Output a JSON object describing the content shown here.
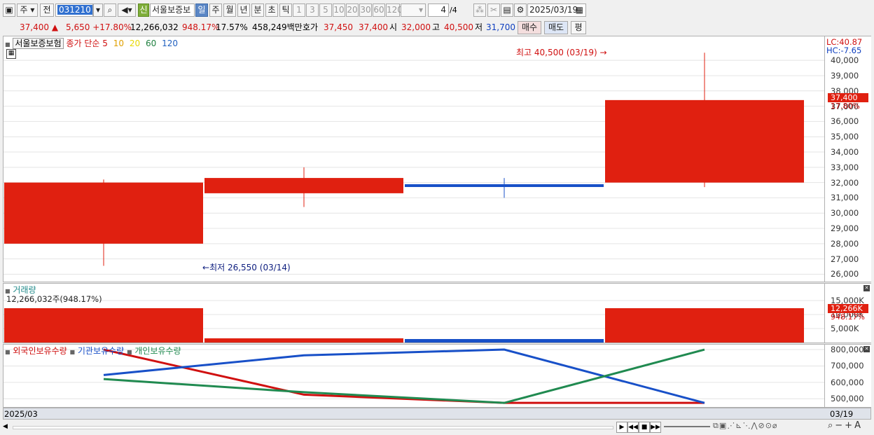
{
  "toolbar": {
    "market": "주",
    "prev": "전",
    "code": "031210",
    "new_badge": "신",
    "stock_name": "서울보증보",
    "periods": [
      "일",
      "주",
      "월",
      "년",
      "분",
      "초",
      "틱"
    ],
    "selected_period": "일",
    "intervals": [
      "1",
      "3",
      "5",
      "10",
      "20",
      "30",
      "60",
      "120"
    ],
    "count": "4",
    "count_total": "/4",
    "date": "2025/03/19"
  },
  "info": {
    "price": "37,400",
    "change": "5,650",
    "change_pct": "+17.80%",
    "volume": "12,266,032",
    "volume_ratio": "948.17%",
    "turnover": "17.57%",
    "amount": "458,249백만",
    "quote_label": "호가",
    "ask": "37,450",
    "bid": "37,400",
    "open_label": "시",
    "open": "32,000",
    "high_label": "고",
    "high": "40,500",
    "low_label": "저",
    "low": "31,700",
    "buy_label": "매수",
    "sell_label": "매도",
    "eval_label": "평"
  },
  "price_panel": {
    "legend_name": "서울보증보험",
    "legend_ma": "종가 단순",
    "ma_periods": [
      {
        "label": "5",
        "color": "#d01010"
      },
      {
        "label": "10",
        "color": "#e0a000"
      },
      {
        "label": "20",
        "color": "#e8d800"
      },
      {
        "label": "60",
        "color": "#208040"
      },
      {
        "label": "120",
        "color": "#2060c0"
      }
    ],
    "high_note": "최고 40,500 (03/19)",
    "low_note": "최저 26,550 (03/14)",
    "lc": "LC:40.87",
    "hc": "HC:-7.65",
    "ticks": [
      "40,000",
      "39,000",
      "38,000",
      "37,000",
      "36,000",
      "35,000",
      "34,000",
      "33,000",
      "32,000",
      "31,000",
      "30,000",
      "29,000",
      "28,000",
      "27,000",
      "26,000"
    ],
    "last_tag": "37,400",
    "last_pct": "17.80%"
  },
  "volume_panel": {
    "title": "거래량",
    "info": "12,266,032주(948.17%)",
    "ticks": [
      "15,000K",
      "10,000K",
      "5,000K"
    ],
    "last_tag": "12,266K",
    "last_pct": "948.17%"
  },
  "holdings_panel": {
    "legend": [
      {
        "label": "외국인보유수량",
        "color": "#d01010"
      },
      {
        "label": "기관보유수량",
        "color": "#1850c8"
      },
      {
        "label": "개인보유수량",
        "color": "#208a50"
      }
    ],
    "ticks": [
      "800,000",
      "700,000",
      "600,000",
      "500,000"
    ]
  },
  "footer": {
    "left_date": "2025/03",
    "right_date": "03/19"
  },
  "chart_data": {
    "type": "candlestick",
    "candles": [
      {
        "open": 32000,
        "high": 32200,
        "low": 26550,
        "close": 28000,
        "color": "#e02010",
        "volume": 12266032
      },
      {
        "open": 31300,
        "high": 33000,
        "low": 30400,
        "close": 32300,
        "color": "#e02010",
        "volume": 1500000
      },
      {
        "open": 31800,
        "high": 32300,
        "low": 31000,
        "close": 31800,
        "color": "#1850c8",
        "volume": 500000
      },
      {
        "open": 32000,
        "high": 40500,
        "low": 31700,
        "close": 37400,
        "color": "#e02010",
        "volume": 12266032
      }
    ],
    "price_ylim": [
      25700,
      41200
    ],
    "volume_ylim": [
      0,
      20000000
    ],
    "holdings": {
      "series": [
        {
          "name": "외국인보유수량",
          "color": "#d01010",
          "values": [
            800000,
            525000,
            475000,
            475000
          ]
        },
        {
          "name": "기관보유수량",
          "color": "#1850c8",
          "values": [
            645000,
            765000,
            800000,
            475000
          ]
        },
        {
          "name": "개인보유수량",
          "color": "#208a50",
          "values": [
            620000,
            540000,
            475000,
            800000
          ]
        }
      ],
      "ylim": [
        450000,
        830000
      ]
    }
  }
}
